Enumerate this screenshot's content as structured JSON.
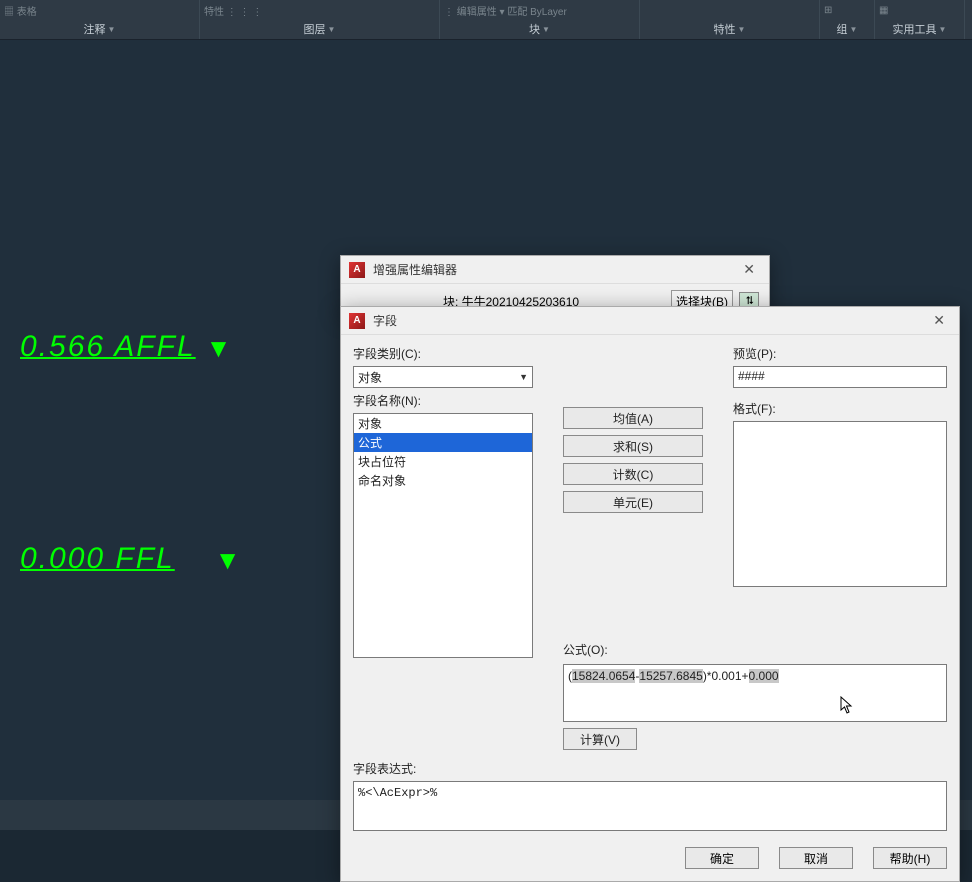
{
  "ribbon": {
    "panels": [
      {
        "top": "▦ 表格",
        "label": "注释"
      },
      {
        "top": "特性 ⋮ ⋮ ⋮",
        "label": "图层"
      },
      {
        "top": "⋮ 编辑属性 ▾  匹配  ByLayer",
        "label": "块"
      },
      {
        "top": "",
        "label": "特性"
      },
      {
        "top": "⊞",
        "label": "组"
      },
      {
        "top": "▦",
        "label": "实用工具"
      }
    ]
  },
  "canvas": {
    "text1": "0.566  AFFL",
    "text2": "0.000  FFL"
  },
  "dlg_back": {
    "title": "增强属性编辑器",
    "block_prefix": "块: ",
    "block_name": "牛牛20210425203610",
    "select_btn": "选择块(B)"
  },
  "dlg_main": {
    "title": "字段",
    "labels": {
      "category": "字段类别(C):",
      "name": "字段名称(N):",
      "preview": "预览(P):",
      "format": "格式(F):",
      "formula": "公式(O):",
      "expr": "字段表达式:"
    },
    "category_value": "对象",
    "name_items": [
      "对象",
      "公式",
      "块占位符",
      "命名对象"
    ],
    "name_selected_index": 1,
    "mid_buttons": [
      "均值(A)",
      "求和(S)",
      "计数(C)",
      "单元(E)"
    ],
    "preview_value": "####",
    "formula_prefix": "(",
    "formula_num1": "15824.0654",
    "formula_minus": "-",
    "formula_num2": "15257.6845",
    "formula_mid": ")*0.001+",
    "formula_num3": "0.000",
    "calc_btn": "计算(V)",
    "expr_value": "%<\\AcExpr>%",
    "ok": "确定",
    "cancel": "取消",
    "help": "帮助(H)"
  }
}
